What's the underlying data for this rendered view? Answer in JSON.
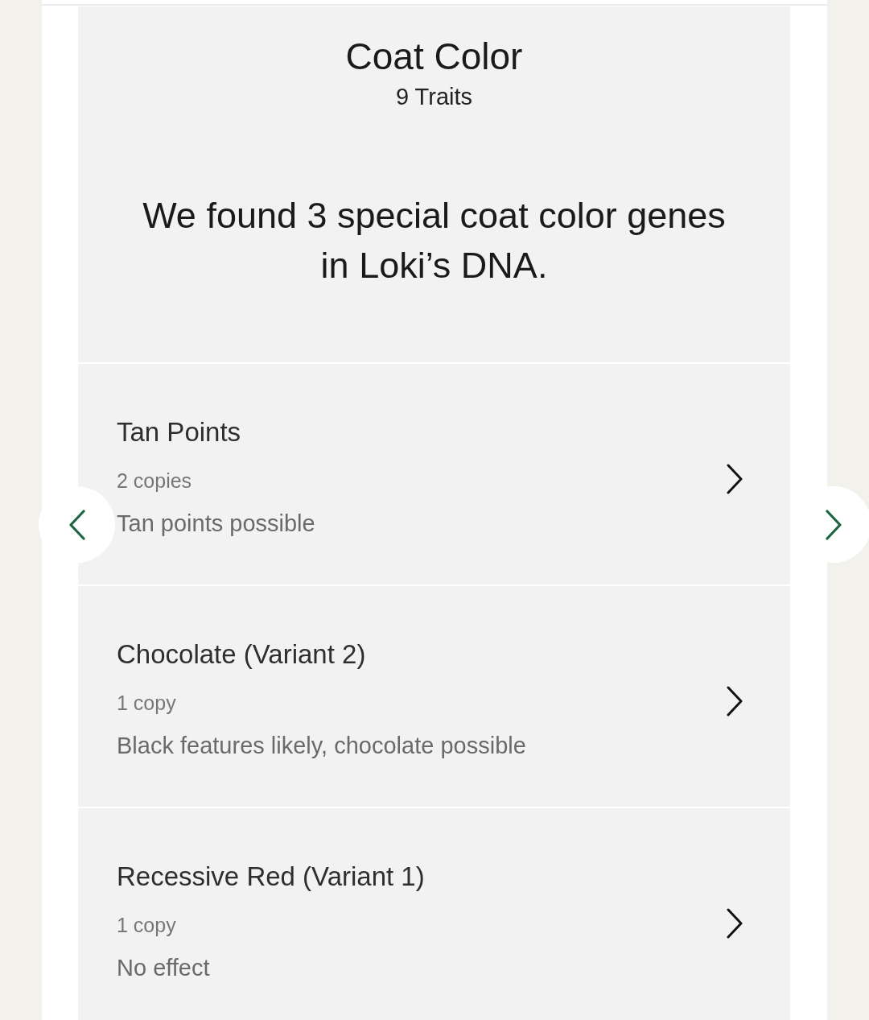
{
  "header": {
    "title": "Coat Color",
    "subtitle": "9 Traits",
    "summary": "We found 3 special coat color genes in Loki’s DNA."
  },
  "traits": [
    {
      "name": "Tan Points",
      "copies": "2 copies",
      "effect": "Tan points possible"
    },
    {
      "name": "Chocolate (Variant 2)",
      "copies": "1 copy",
      "effect": "Black features likely, chocolate possible"
    },
    {
      "name": "Recessive Red (Variant 1)",
      "copies": "1 copy",
      "effect": "No effect"
    }
  ]
}
